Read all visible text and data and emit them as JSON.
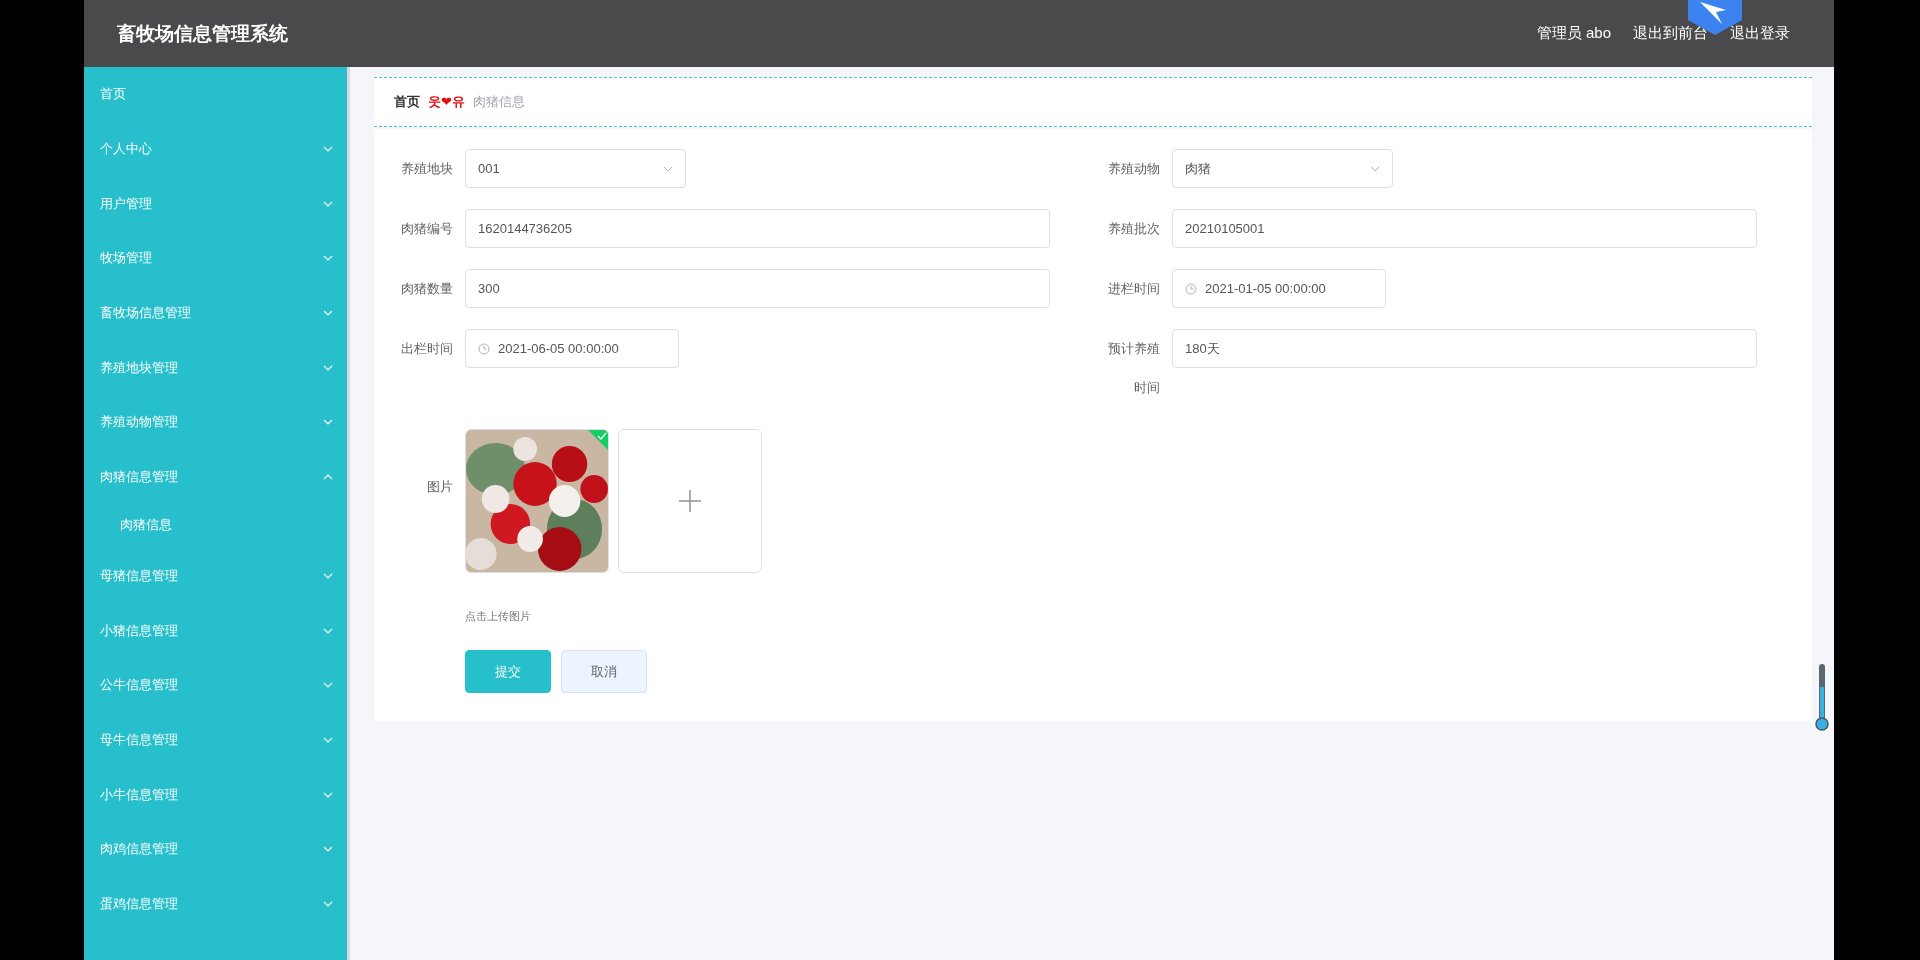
{
  "header": {
    "title": "畜牧场信息管理系统",
    "user_label": "管理员 abo",
    "links": [
      "退出到前台",
      "退出登录"
    ]
  },
  "sidebar": {
    "items": [
      {
        "label": "首页",
        "expandable": false
      },
      {
        "label": "个人中心",
        "expandable": true,
        "expanded": false
      },
      {
        "label": "用户管理",
        "expandable": true,
        "expanded": false
      },
      {
        "label": "牧场管理",
        "expandable": true,
        "expanded": false
      },
      {
        "label": "畜牧场信息管理",
        "expandable": true,
        "expanded": false
      },
      {
        "label": "养殖地块管理",
        "expandable": true,
        "expanded": false
      },
      {
        "label": "养殖动物管理",
        "expandable": true,
        "expanded": false
      },
      {
        "label": "肉猪信息管理",
        "expandable": true,
        "expanded": true,
        "children": [
          {
            "label": "肉猪信息"
          }
        ]
      },
      {
        "label": "母猪信息管理",
        "expandable": true,
        "expanded": false
      },
      {
        "label": "小猪信息管理",
        "expandable": true,
        "expanded": false
      },
      {
        "label": "公牛信息管理",
        "expandable": true,
        "expanded": false
      },
      {
        "label": "母牛信息管理",
        "expandable": true,
        "expanded": false
      },
      {
        "label": "小牛信息管理",
        "expandable": true,
        "expanded": false
      },
      {
        "label": "肉鸡信息管理",
        "expandable": true,
        "expanded": false
      },
      {
        "label": "蛋鸡信息管理",
        "expandable": true,
        "expanded": false
      }
    ]
  },
  "breadcrumb": {
    "items": [
      "首页",
      "肉猪信息"
    ],
    "separator": "웃❤유"
  },
  "form": {
    "fields": [
      {
        "label": "养殖地块",
        "kind": "select",
        "value": "001"
      },
      {
        "label": "养殖动物",
        "kind": "select",
        "value": "肉猪"
      },
      {
        "label": "肉猪编号",
        "kind": "text",
        "value": "1620144736205"
      },
      {
        "label": "养殖批次",
        "kind": "text",
        "value": "20210105001"
      },
      {
        "label": "肉猪数量",
        "kind": "text",
        "value": "300"
      },
      {
        "label": "进栏时间",
        "kind": "date",
        "value": "2021-01-05 00:00:00"
      },
      {
        "label": "出栏时间",
        "kind": "date",
        "value": "2021-06-05 00:00:00"
      },
      {
        "label": "预计养殖时间",
        "kind": "text",
        "value": "180天"
      }
    ],
    "upload": {
      "label": "图片",
      "hint": "点击上传图片",
      "images": [
        {
          "kind": "picture",
          "uploaded": true
        }
      ]
    },
    "buttons": [
      {
        "label": "提交",
        "kind": "primary"
      },
      {
        "label": "取消",
        "kind": "default"
      }
    ]
  }
}
